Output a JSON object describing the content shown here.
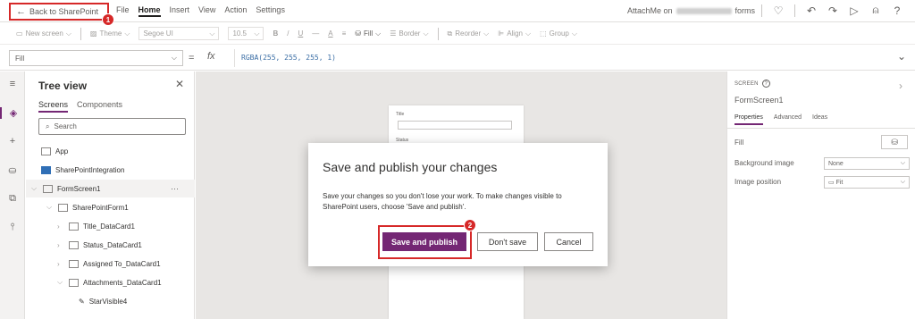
{
  "topbar": {
    "back_label": "Back to SharePoint",
    "menu": [
      "File",
      "Home",
      "Insert",
      "View",
      "Action",
      "Settings"
    ],
    "active_menu": "Home",
    "app_title_prefix": "AttachMe on",
    "app_title_suffix": "forms",
    "annotation_1": "1"
  },
  "toolbar": {
    "new_screen": "New screen",
    "theme": "Theme",
    "font": "Segoe UI",
    "font_size": "10.5",
    "bold": "B",
    "italic": "/",
    "underline": "U",
    "strike": "—",
    "font_color": "A",
    "fill": "Fill",
    "border": "Border",
    "reorder": "Reorder",
    "align": "Align",
    "group": "Group"
  },
  "formula": {
    "property": "Fill",
    "equals": "=",
    "fx": "fx",
    "value": "RGBA(255, 255, 255, 1)"
  },
  "tree": {
    "title": "Tree view",
    "tabs": [
      "Screens",
      "Components"
    ],
    "search_placeholder": "Search",
    "nodes": {
      "app": "App",
      "sp_integration": "SharePointIntegration",
      "form_screen": "FormScreen1",
      "sp_form": "SharePointForm1",
      "title_card": "Title_DataCard1",
      "status_card": "Status_DataCard1",
      "assigned_card": "Assigned To_DataCard1",
      "attachments_card": "Attachments_DataCard1",
      "star_visible": "StarVisible4"
    },
    "dots": "···"
  },
  "canvas": {
    "title_label": "Title",
    "status_label": "Status"
  },
  "dialog": {
    "title": "Save and publish your changes",
    "body": "Save your changes so you don't lose your work. To make changes visible to SharePoint users, choose 'Save and publish'.",
    "primary": "Save and publish",
    "dont_save": "Don't save",
    "cancel": "Cancel",
    "annotation_2": "2"
  },
  "props": {
    "caption": "SCREEN",
    "help": "?",
    "name": "FormScreen1",
    "tabs": [
      "Properties",
      "Advanced",
      "Ideas"
    ],
    "fill_label": "Fill",
    "bg_image_label": "Background image",
    "bg_image_value": "None",
    "img_pos_label": "Image position",
    "img_pos_value": "Fit"
  },
  "colors": {
    "accent": "#742774",
    "annotation_red": "#d62828"
  }
}
